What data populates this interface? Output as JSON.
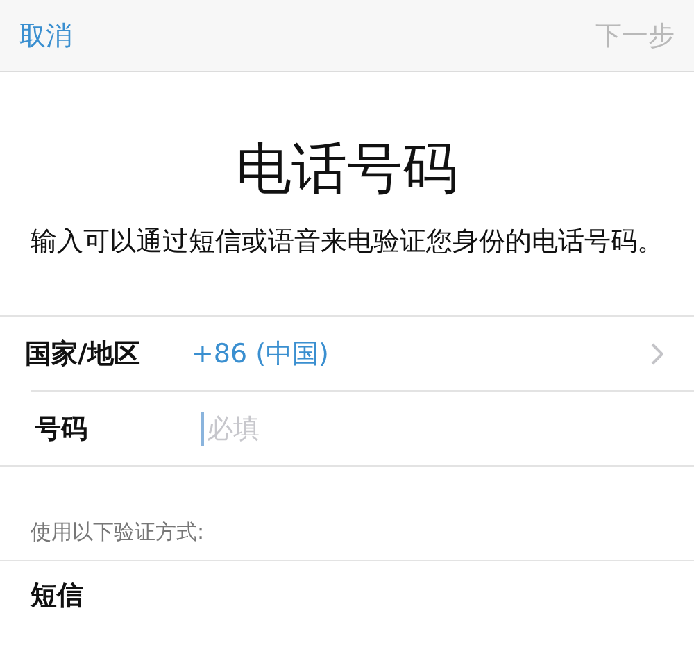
{
  "nav": {
    "cancel": "取消",
    "next": {
      "label": "下一步",
      "disabled": true
    }
  },
  "title": "电话号码",
  "description": "输入可以通过短信或语音来电验证您身份的电话号码。",
  "form": [
    {
      "kind": "select",
      "label": "国家/地区",
      "value": "+86 (中国)"
    },
    {
      "kind": "input",
      "label": "号码",
      "placeholder": "必填"
    }
  ],
  "methods_header": "使用以下验证方式:",
  "methods": [
    {
      "label": "短信"
    }
  ]
}
